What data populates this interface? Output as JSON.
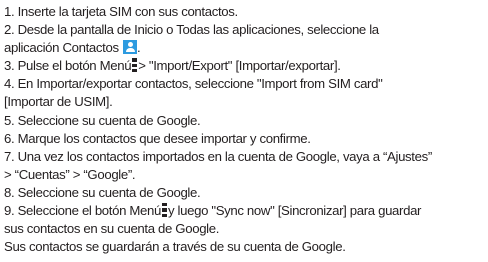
{
  "steps": {
    "s1": "1. Inserte la tarjeta SIM con sus contactos.",
    "s2_line1": "2. Desde la pantalla de Inicio o Todas las aplicaciones, seleccione la",
    "s2_line2": "aplicación Contactos",
    "s2_end": ".",
    "s3_start": "3. Pulse el botón Menú",
    "s3_end": "> \"Import/Export\" [Importar/exportar].",
    "s4_line1": "4. En Importar/exportar contactos, seleccione \"Import from SIM card\"",
    "s4_line2": "[Importar de USIM].",
    "s5": "5. Seleccione su cuenta de Google.",
    "s6": "6. Marque los contactos que desee importar y confirme.",
    "s7_line1": "7. Una vez los contactos importados en la cuenta de Google, vaya a “Ajustes”",
    "s7_line2": "> “Cuentas” > “Google”.",
    "s8": "8. Seleccione su cuenta de Google.",
    "s9_start": "9. Seleccione el botón Menú",
    "s9_end": "y luego \"Sync now\" [Sincronizar] para guardar",
    "s9_line2": "sus contactos en su cuenta de Google.",
    "closing": "Sus contactos se guardarán a través de su cuenta de Google."
  },
  "icons": {
    "contacts": "contacts-app-icon",
    "menu": "menu-dots-icon",
    "contacts_color": "#2d9be0"
  }
}
